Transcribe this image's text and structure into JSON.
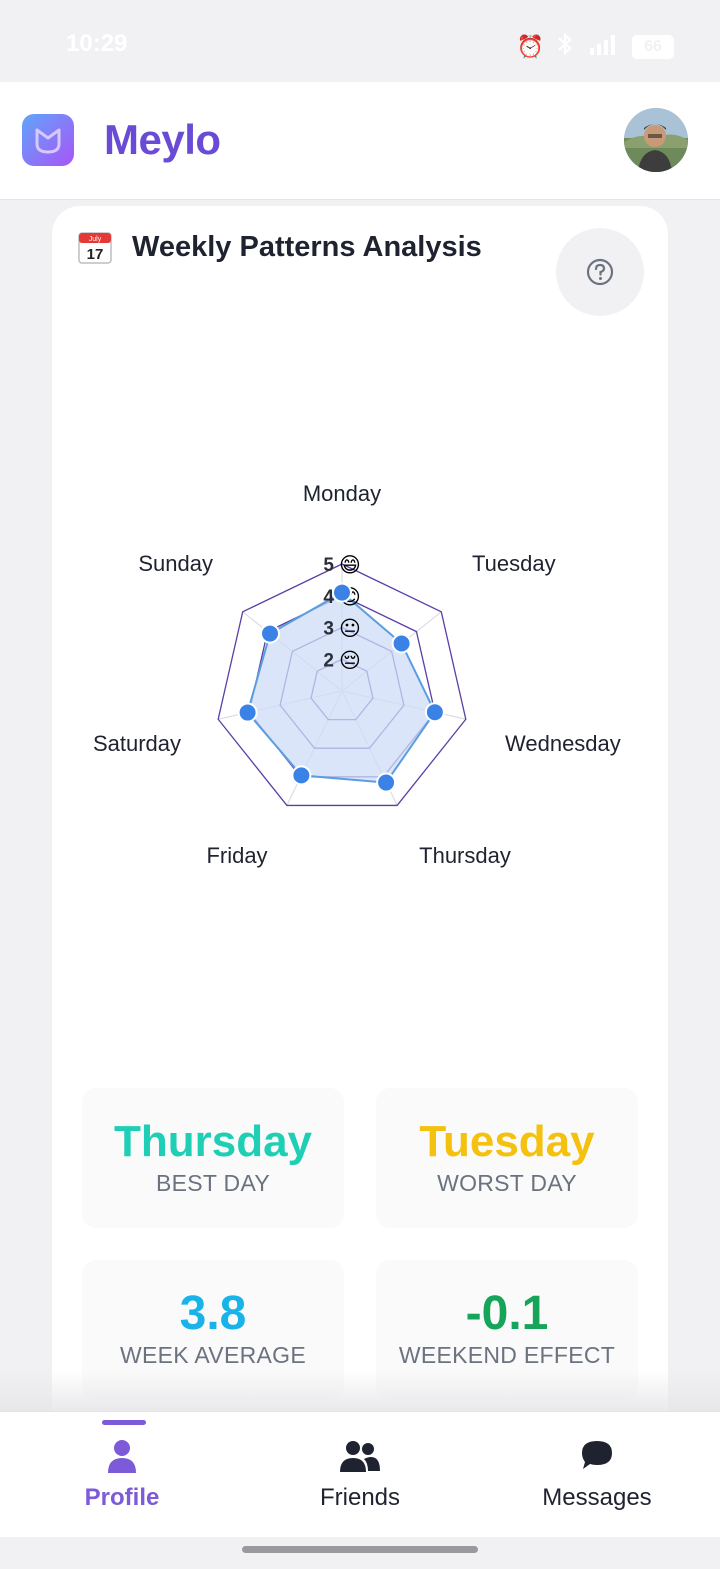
{
  "status_bar": {
    "time": "10:29",
    "battery": "66",
    "icons": [
      "alarm-icon",
      "bluetooth-icon",
      "signal-icon",
      "battery-icon"
    ]
  },
  "app": {
    "name": "Meylo",
    "brand_color": "#6a4bd6"
  },
  "card": {
    "title": "Weekly Patterns Analysis",
    "icon": "calendar-icon",
    "calendar_month": "July",
    "calendar_day": "17",
    "help_icon": "question-circle-icon"
  },
  "chart_data": {
    "type": "radar",
    "categories": [
      "Monday",
      "Tuesday",
      "Wednesday",
      "Thursday",
      "Friday",
      "Saturday",
      "Sunday"
    ],
    "values": [
      4.1,
      3.4,
      4.0,
      4.2,
      3.95,
      4.05,
      3.9
    ],
    "rlim": [
      1,
      5
    ],
    "scale_labels": [
      {
        "value": 5,
        "label": "5",
        "emoji": "😄"
      },
      {
        "value": 4,
        "label": "4",
        "emoji": "😊"
      },
      {
        "value": 3,
        "label": "3",
        "emoji": "😐"
      },
      {
        "value": 2,
        "label": "2",
        "emoji": "😔"
      }
    ],
    "colors": {
      "grid": "#5b3fa6",
      "spokes": "#dcdce3",
      "fill": "#cfdcf7",
      "line": "#5b9ee0",
      "point": "#3b82e6"
    }
  },
  "stats": [
    {
      "value": "Thursday",
      "label": "BEST DAY",
      "color": "#1fcfb5"
    },
    {
      "value": "Tuesday",
      "label": "WORST DAY",
      "color": "#f4c10f"
    },
    {
      "value": "3.8",
      "label": "WEEK AVERAGE",
      "color": "#18b3e8"
    },
    {
      "value": "-0.1",
      "label": "WEEKEND EFFECT",
      "color": "#16a35a"
    }
  ],
  "nav": {
    "items": [
      {
        "label": "Profile",
        "icon": "person-icon",
        "active": true
      },
      {
        "label": "Friends",
        "icon": "people-icon",
        "active": false
      },
      {
        "label": "Messages",
        "icon": "chat-bubble-icon",
        "active": false
      }
    ],
    "active_color": "#7c5ad8",
    "inactive_color": "#1f2330"
  }
}
